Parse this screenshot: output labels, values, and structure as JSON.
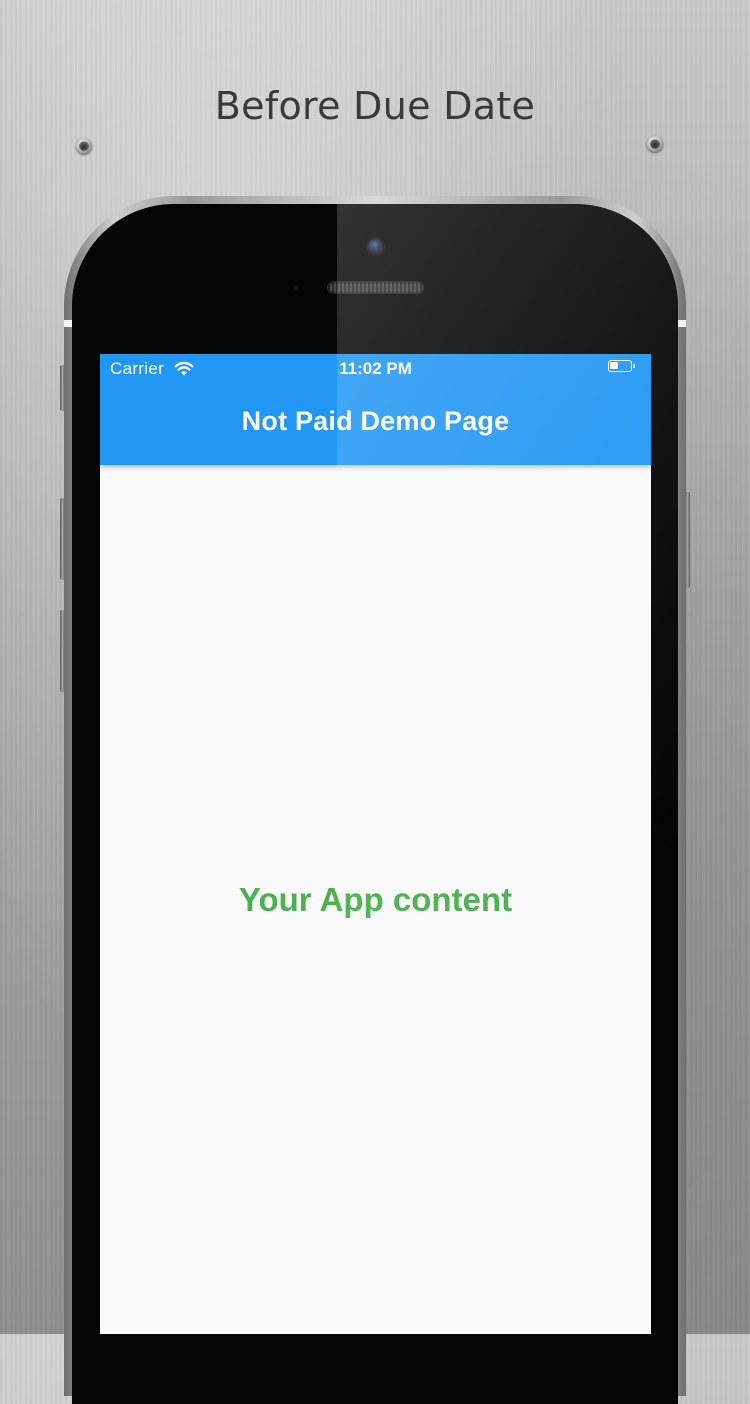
{
  "caption": "Before Due Date",
  "status_bar": {
    "carrier": "Carrier",
    "time": "11:02 PM",
    "wifi_icon": "wifi-icon",
    "battery_icon": "battery-icon"
  },
  "app_bar": {
    "title": "Not Paid Demo Page",
    "color": "#2196f3"
  },
  "body": {
    "content_text": "Your App content",
    "content_color": "#4caf50"
  }
}
